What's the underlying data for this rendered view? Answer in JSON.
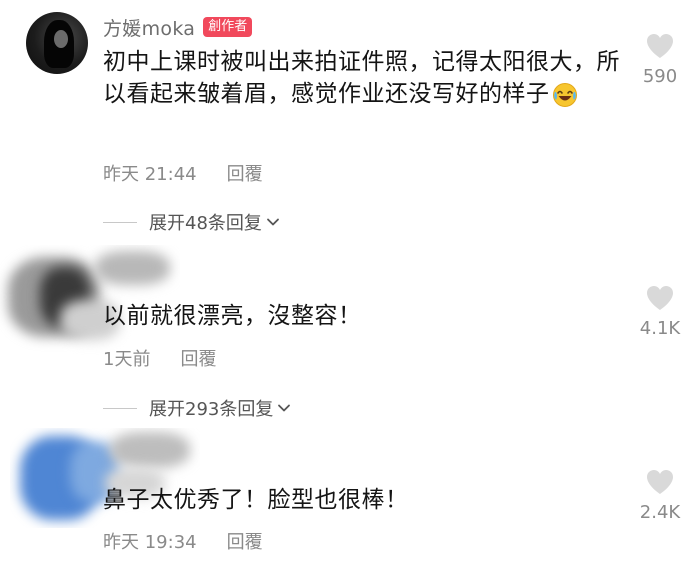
{
  "comments": [
    {
      "author": "方媛moka",
      "badge": "創作者",
      "text": "初中上课时被叫出来拍证件照，记得太阳很大，所以看起来皱着眉，感觉作业还没写好的样子",
      "emoji": "laughing-tears-emoji",
      "time": "昨天 21:44",
      "reply_label": "回覆",
      "likes": "590",
      "expand_label": "展开48条回复"
    },
    {
      "text": "以前就很漂亮，沒整容！",
      "time": "1天前",
      "reply_label": "回覆",
      "likes": "4.1K",
      "expand_label": "展开293条回复"
    },
    {
      "text": "鼻子太优秀了！脸型也很棒！",
      "time": "昨天 19:34",
      "reply_label": "回覆",
      "likes": "2.4K"
    }
  ],
  "icons": {
    "like": "heart-icon",
    "expand": "chevron-down-icon"
  },
  "colors": {
    "badge_bg": "#f1495c",
    "meta_text": "#8a8a8a",
    "heart": "#d9d9d9"
  }
}
